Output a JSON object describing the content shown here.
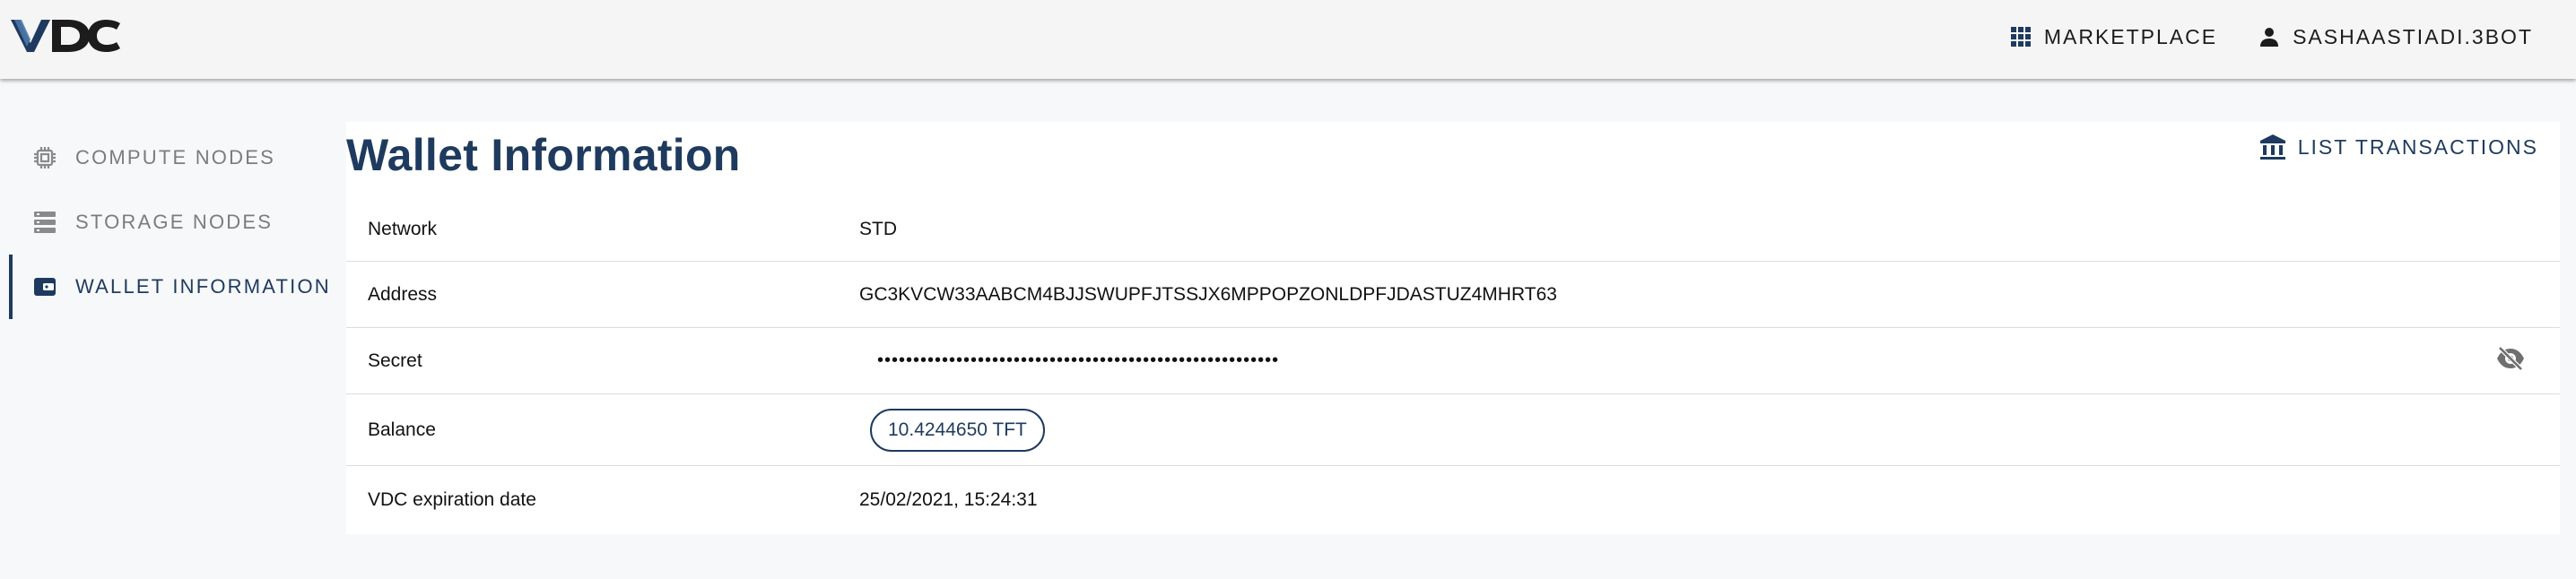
{
  "header": {
    "logo_text": "VDC",
    "marketplace_label": "MARKETPLACE",
    "user_label": "SASHAASTIADI.3BOT"
  },
  "sidebar": {
    "items": [
      {
        "label": "COMPUTE NODES",
        "icon": "chip-icon",
        "active": false
      },
      {
        "label": "STORAGE NODES",
        "icon": "storage-icon",
        "active": false
      },
      {
        "label": "WALLET INFORMATION",
        "icon": "wallet-icon",
        "active": true
      }
    ]
  },
  "main": {
    "title": "Wallet Information",
    "list_transactions_label": "LIST TRANSACTIONS",
    "rows": [
      {
        "key": "Network",
        "value": "STD"
      },
      {
        "key": "Address",
        "value": "GC3KVCW33AABCM4BJJSWUPFJTSSJX6MPPOPZONLDPFJDASTUZ4MHRT63"
      },
      {
        "key": "Secret",
        "value": "••••••••••••••••••••••••••••••••••••••••••••••••••••••••"
      },
      {
        "key": "Balance",
        "value": "10.4244650 TFT"
      },
      {
        "key": "VDC expiration date",
        "value": "25/02/2021, 15:24:31"
      }
    ]
  },
  "colors": {
    "accent": "#1e3a5f",
    "muted_text": "#7c7c7c",
    "topbar_bg": "#f5f5f5",
    "page_bg": "#f7f8fa"
  }
}
